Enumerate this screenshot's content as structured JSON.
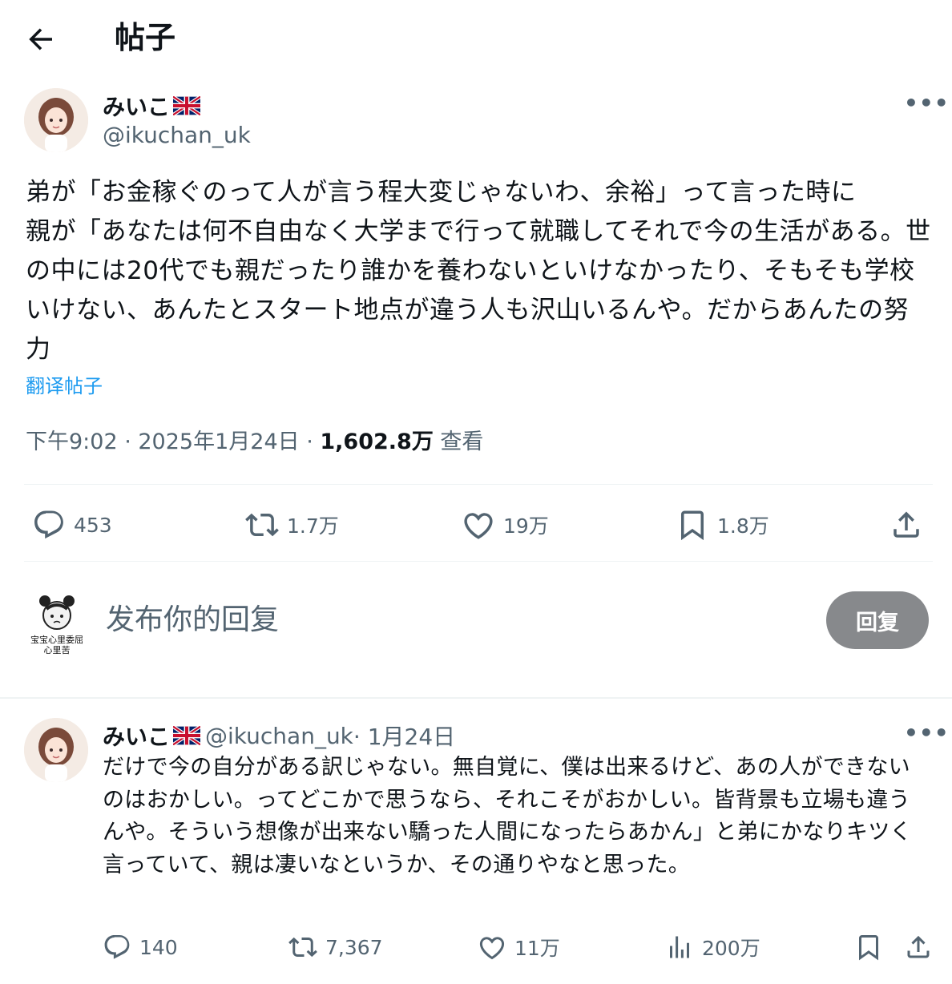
{
  "header": {
    "title": "帖子"
  },
  "post": {
    "name": "みいこ",
    "handle": "@ikuchan_uk",
    "text": "弟が「お金稼ぐのって人が言う程大変じゃないわ、余裕」って言った時に\n親が「あなたは何不自由なく大学まで行って就職してそれで今の生活がある。世の中には20代でも親だったり誰かを養わないといけなかったり、そもそも学校いけない、あんたとスタート地点が違う人も沢山いるんや。だからあんたの努力",
    "translate": "翻译帖子",
    "time": "下午9:02 · 2025年1月24日 · ",
    "views": "1,602.8万",
    "views_label": " 查看",
    "stats": {
      "replies": "453",
      "reposts": "1.7万",
      "likes": "19万",
      "bookmarks": "1.8万"
    }
  },
  "compose": {
    "placeholder": "发布你的回复",
    "button": "回复",
    "avatar_caption_1": "宝宝心里委屈",
    "avatar_caption_2": "心里苦"
  },
  "reply": {
    "name": "みいこ",
    "handle": "@ikuchan_uk",
    "date": " · 1月24日",
    "text": "だけで今の自分がある訳じゃない。無自覚に、僕は出来るけど、あの人ができないのはおかしい。ってどこかで思うなら、それこそがおかしい。皆背景も立場も違うんや。そういう想像が出来ない驕った人間になったらあかん」と弟にかなりキツく言っていて、親は凄いなというか、その通りやなと思った。",
    "stats": {
      "replies": "140",
      "reposts": "7,367",
      "likes": "11万",
      "views": "200万"
    }
  },
  "colors": {
    "accent": "#1d9bf0",
    "secondary": "#536471",
    "button_bg": "#87898c"
  }
}
